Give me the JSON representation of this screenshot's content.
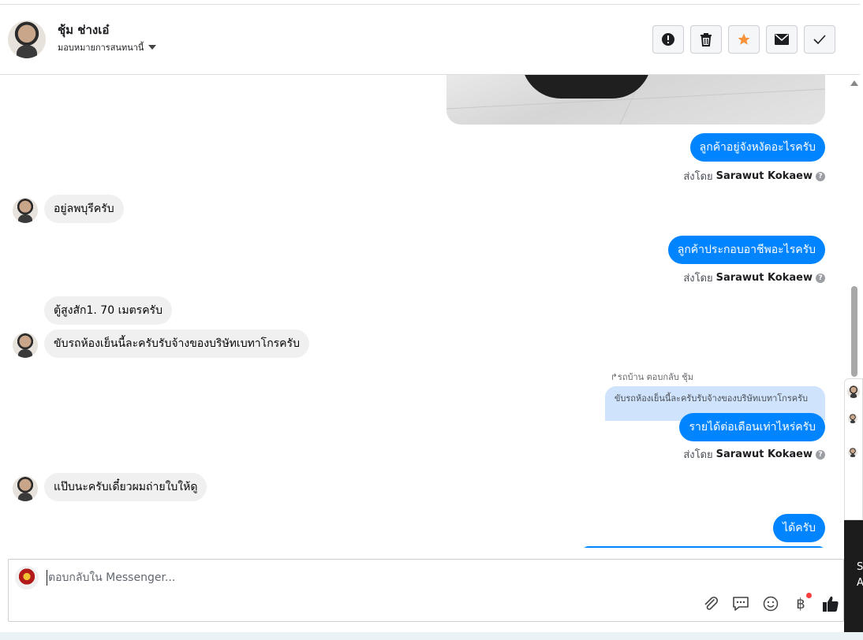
{
  "header": {
    "name": "ชุ้ม ช่างเอ๋",
    "assign_label": "มอบหมายการสนทนานี้",
    "buttons": {
      "spam_icon": "alert-icon",
      "delete_icon": "trash-icon",
      "star_icon": "star-icon",
      "mark_unread_icon": "envelope-icon",
      "done_icon": "check-icon"
    }
  },
  "messages": {
    "m1": "ลูกค้าอยู่จังหงัดอะไรครับ",
    "m2": "อยู่ลพบุรีครับ",
    "m3": "ลูกค้าประกอบอาชีพอะไรครับ",
    "m4": "ตู้สูงสัก1. 70 เมตรครับ",
    "m5": "ขับรถห้องเย็นนี้ละครับรับจ้างของบริษัทเบทาโกรครับ",
    "reply_label": "รถบ้าน ตอบกลับ ชุ้ม",
    "quoted": "ขับรถห้องเย็นนี้ละครับรับจ้างของบริษัทเบทาโกรครับ",
    "m6": "รายได้ต่อเดือนเท่าไหร่ครับ",
    "m7": "แป๊บนะครับเดี๋ยวผมถ่ายใบให้ดู",
    "m8": "ได้ครับ"
  },
  "sent_by": {
    "prefix": "ส่งโดย",
    "name": "Sarawut Kokaew",
    "help": "?"
  },
  "composer": {
    "placeholder": "ตอบกลับใน Messenger...",
    "tools": [
      "attach-icon",
      "saved-reply-icon",
      "emoji-icon",
      "baht-icon",
      "like-icon"
    ],
    "baht": "฿"
  },
  "side_panel": {
    "line1": "S",
    "line2": "A"
  },
  "colors": {
    "accent": "#0084ff",
    "incoming": "#f0f0f0",
    "quote": "#cfe3fc",
    "star": "#f7923a"
  }
}
